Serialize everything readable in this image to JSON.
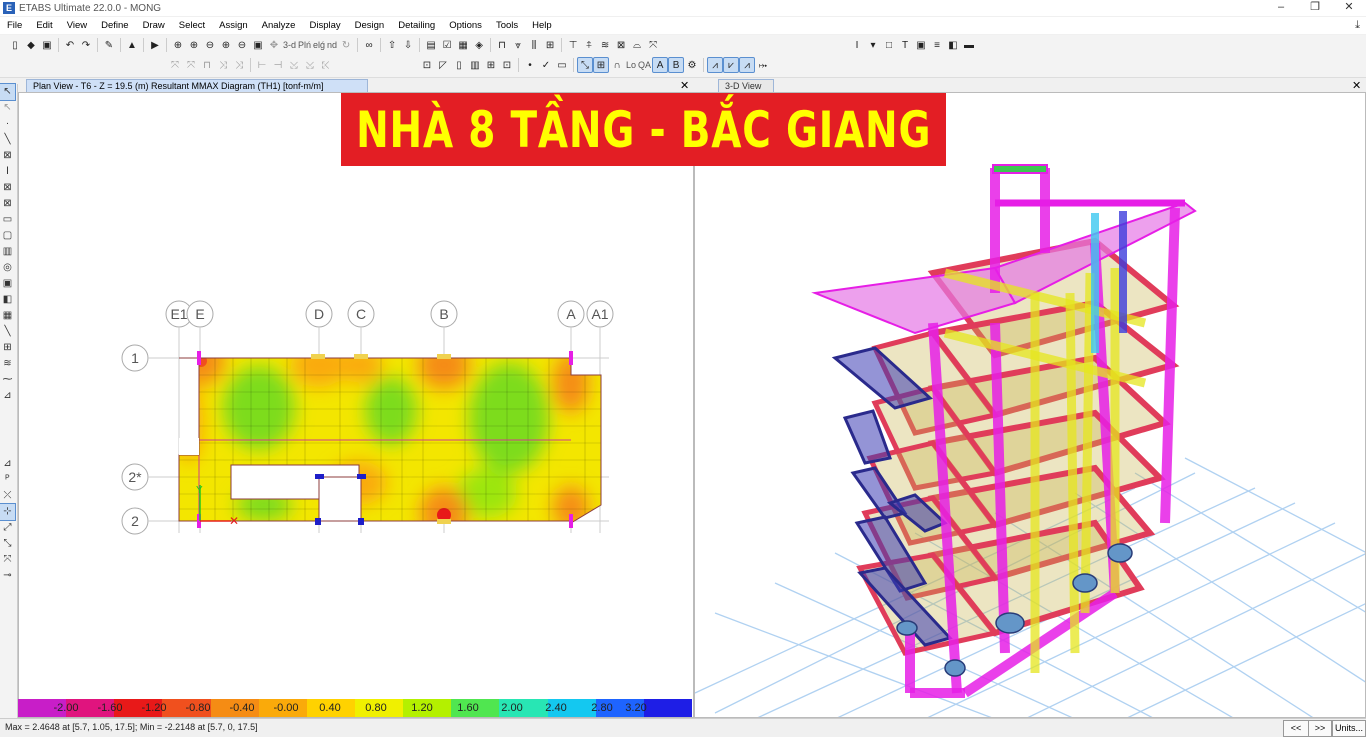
{
  "window": {
    "title": "ETABS Ultimate 22.0.0 - MONG",
    "app_icon": "E"
  },
  "menu": [
    "File",
    "Edit",
    "View",
    "Define",
    "Draw",
    "Select",
    "Assign",
    "Analyze",
    "Display",
    "Design",
    "Detailing",
    "Options",
    "Tools",
    "Help"
  ],
  "toolbar": {
    "view_3d": "3-d",
    "plan": "Plń",
    "elev": "elǵ",
    "nd": "nd",
    "all": "all",
    "lo": "Lo",
    "qa": "QA",
    "a": "A",
    "b": "B"
  },
  "panes": {
    "left_tab": "Plan View - T6 - Z = 19.5 (m)    Resultant MMAX Diagram    (TH1)  [tonf-m/m]",
    "right_tab": "3-D View",
    "close_glyph": "✕"
  },
  "banner": {
    "text": "NHÀ 8 TẦNG - BẮC GIANG",
    "bg": "#e31e24",
    "fg": "#ffff00"
  },
  "grid": {
    "columns": [
      "E1",
      "E",
      "D",
      "C",
      "B",
      "A",
      "A1"
    ],
    "rows": [
      "1",
      "2*",
      "2"
    ]
  },
  "legend": {
    "labels": [
      "-2.00",
      "-1.60",
      "-1.20",
      "-0.80",
      "-0.40",
      "-0.00",
      "0.40",
      "0.80",
      "1.20",
      "1.60",
      "2.00",
      "2.40",
      "2.80",
      "3.20"
    ],
    "colors": [
      "#c81ec8",
      "#e0147e",
      "#e81919",
      "#f0501e",
      "#f58c14",
      "#faaa0a",
      "#ffd200",
      "#f0f000",
      "#b4f000",
      "#50e650",
      "#28e6b4",
      "#14c8f0",
      "#1e64ff",
      "#1e1ee6"
    ]
  },
  "status": {
    "text": "Max = 2.4648 at [5.7, 1.05, 17.5];  Min = -2.2148 at [5.7, 0, 17.5]",
    "prev": "<<",
    "next": ">>",
    "units": "Units..."
  }
}
